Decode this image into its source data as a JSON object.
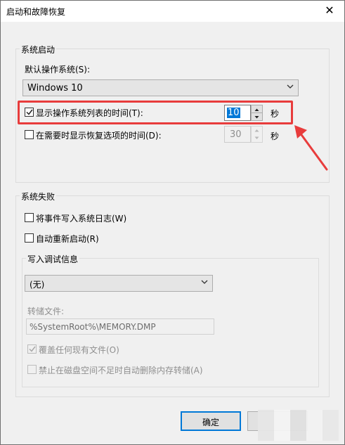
{
  "window": {
    "title": "启动和故障恢复",
    "close_glyph": "✕"
  },
  "system_startup": {
    "group_label": "系统启动",
    "default_os_label": "默认操作系统(S):",
    "default_os_value": "Windows 10",
    "show_os_list": {
      "label": "显示操作系统列表的时间(T):",
      "checked": true,
      "value": "10",
      "unit": "秒"
    },
    "show_recovery": {
      "label": "在需要时显示恢复选项的时间(D):",
      "checked": false,
      "value": "30",
      "unit": "秒"
    }
  },
  "system_failure": {
    "group_label": "系统失败",
    "write_event_log": {
      "label": "将事件写入系统日志(W)",
      "checked": false
    },
    "auto_restart": {
      "label": "自动重新启动(R)",
      "checked": false
    },
    "debug_info": {
      "group_label": "写入调试信息",
      "dropdown_value": "(无)",
      "dump_file_label": "转储文件:",
      "dump_file_value": "%SystemRoot%\\MEMORY.DMP",
      "overwrite": {
        "label": "覆盖任何现有文件(O)",
        "checked": true
      },
      "disable_autodelete": {
        "label": "禁止在磁盘空间不足时自动删除内存转储(A)",
        "checked": false
      }
    }
  },
  "footer": {
    "ok_label": "确定"
  },
  "colors": {
    "highlight": "#e83c3c",
    "default_button_border": "#0078d7",
    "selection": "#0078d7"
  }
}
